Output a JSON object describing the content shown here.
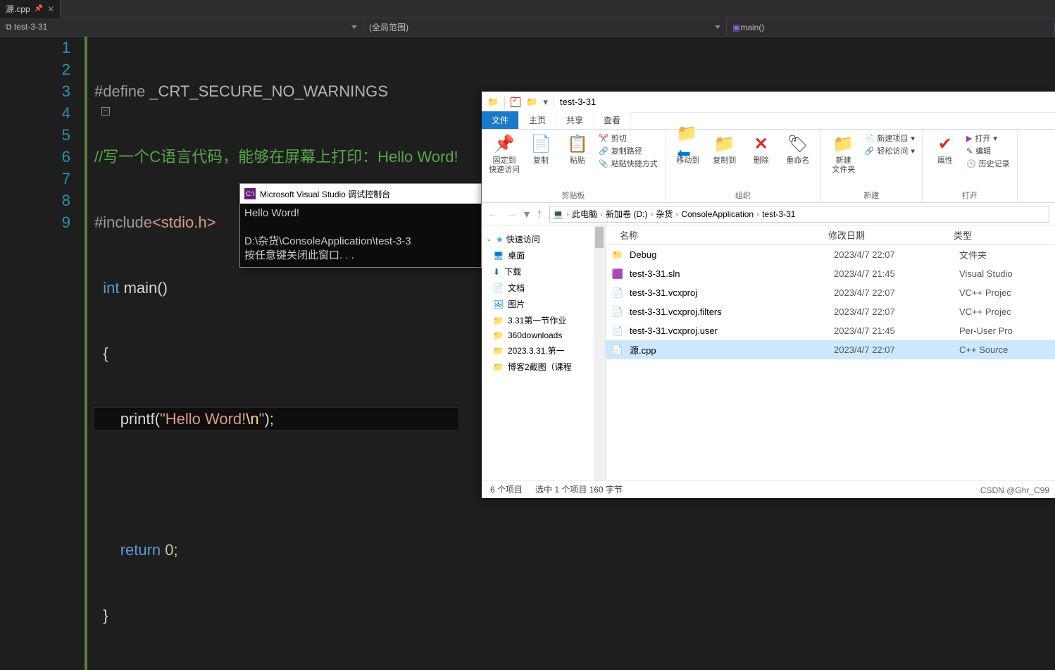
{
  "vs": {
    "tab_filename": "源.cpp",
    "nav_left": "test-3-31",
    "nav_mid": "(全局范围)",
    "nav_right": "main()"
  },
  "code": {
    "l1_define": "#define",
    "l1_macro": "_CRT_SECURE_NO_WARNINGS",
    "l2_comment": "//写一个C语言代码，能够在屏幕上打印：Hello Word!",
    "l3_include": "#include",
    "l3_header": "<stdio.h>",
    "l4_int": "int",
    "l4_main": " main()",
    "l5_brace": "{",
    "l6_indent": "    ",
    "l6_printf": "printf",
    "l6_paren1": "(",
    "l6_str1": "\"Hello Word!",
    "l6_esc": "\\n",
    "l6_str2": "\"",
    "l6_paren2": ");",
    "l8_indent": "    ",
    "l8_return": "return",
    "l8_zero": " 0",
    "l8_semi": ";",
    "l9_brace": "}",
    "line_numbers": [
      "1",
      "2",
      "3",
      "4",
      "5",
      "6",
      "7",
      "8",
      "9"
    ]
  },
  "console": {
    "title": "Microsoft Visual Studio 调试控制台",
    "out_line1": "Hello Word!",
    "out_line2": "D:\\杂货\\ConsoleApplication\\test-3-3",
    "out_line3": "按任意键关闭此窗口. . ."
  },
  "explorer": {
    "title": "test-3-31",
    "tabs": {
      "file": "文件",
      "home": "主页",
      "share": "共享",
      "view": "查看"
    },
    "ribbon": {
      "pin": "固定到\n快速访问",
      "copy": "复制",
      "paste": "粘贴",
      "cut": "剪切",
      "copypath": "复制路径",
      "pasteShortcut": "粘贴快捷方式",
      "clipboard": "剪贴板",
      "moveto": "移动到",
      "copyto": "复制到",
      "delete": "删除",
      "rename": "重命名",
      "organize": "组织",
      "newfolder": "新建\n文件夹",
      "newitem": "新建项目",
      "easyaccess": "轻松访问",
      "new": "新建",
      "properties": "属性",
      "openlbl": "打开",
      "edit": "编辑",
      "history": "历史记录",
      "open_group": "打开"
    },
    "crumbs": [
      "此电脑",
      "新加卷 (D:)",
      "杂货",
      "ConsoleApplication",
      "test-3-31"
    ],
    "tree": {
      "quick": "快速访问",
      "desktop": "桌面",
      "downloads": "下载",
      "documents": "文档",
      "pictures": "图片",
      "f1": "3.31第一节作业",
      "f2": "360downloads",
      "f3": "2023.3.31.第一",
      "f4": "博客2截图（课程"
    },
    "cols": {
      "name": "名称",
      "date": "修改日期",
      "type": "类型"
    },
    "files": [
      {
        "name": "Debug",
        "date": "2023/4/7 22:07",
        "type": "文件夹",
        "icon": "folder"
      },
      {
        "name": "test-3-31.sln",
        "date": "2023/4/7 21:45",
        "type": "Visual Studio",
        "icon": "sln"
      },
      {
        "name": "test-3-31.vcxproj",
        "date": "2023/4/7 22:07",
        "type": "VC++ Projec",
        "icon": "proj"
      },
      {
        "name": "test-3-31.vcxproj.filters",
        "date": "2023/4/7 22:07",
        "type": "VC++ Projec",
        "icon": "proj"
      },
      {
        "name": "test-3-31.vcxproj.user",
        "date": "2023/4/7 21:45",
        "type": "Per-User Pro",
        "icon": "proj"
      },
      {
        "name": "源.cpp",
        "date": "2023/4/7 22:07",
        "type": "C++ Source",
        "icon": "file",
        "selected": true
      }
    ],
    "status": {
      "count": "6 个项目",
      "selected": "选中 1 个项目 160 字节"
    }
  },
  "watermark": "CSDN @Ghr_C99"
}
